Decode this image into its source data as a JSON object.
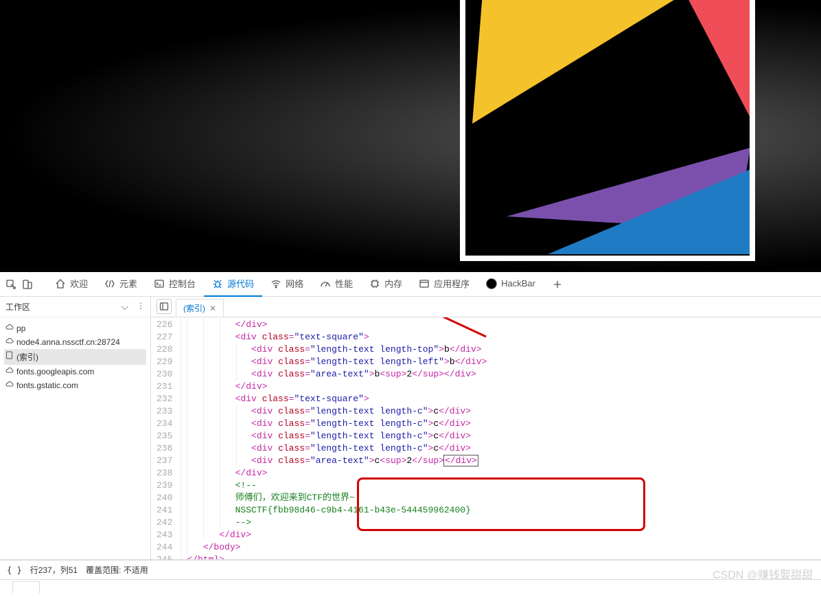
{
  "devtools": {
    "tabs": {
      "welcome": "欢迎",
      "elements": "元素",
      "console": "控制台",
      "sources": "源代码",
      "network": "网络",
      "performance": "性能",
      "memory": "内存",
      "application": "应用程序",
      "hackbar": "HackBar"
    }
  },
  "sidebar": {
    "title": "工作区",
    "items": [
      "pp",
      "node4.anna.nssctf.cn:28724",
      "(索引)",
      "fonts.googleapis.com",
      "fonts.gstatic.com"
    ]
  },
  "editor": {
    "tab": "(索引)",
    "startLine": 226,
    "lines": [
      {
        "indent": 3,
        "segs": [
          [
            "punc",
            "</"
          ],
          [
            "tag",
            "div"
          ],
          [
            "punc",
            ">"
          ]
        ]
      },
      {
        "indent": 3,
        "segs": [
          [
            "punc",
            "<"
          ],
          [
            "tag",
            "div"
          ],
          [
            "text",
            " "
          ],
          [
            "attr",
            "class"
          ],
          [
            "punc",
            "="
          ],
          [
            "str",
            "\"text-square\""
          ],
          [
            "punc",
            ">"
          ]
        ]
      },
      {
        "indent": 4,
        "segs": [
          [
            "punc",
            "<"
          ],
          [
            "tag",
            "div"
          ],
          [
            "text",
            " "
          ],
          [
            "attr",
            "class"
          ],
          [
            "punc",
            "="
          ],
          [
            "str",
            "\"length-text length-top\""
          ],
          [
            "punc",
            ">"
          ],
          [
            "text",
            "b"
          ],
          [
            "punc",
            "</"
          ],
          [
            "tag",
            "div"
          ],
          [
            "punc",
            ">"
          ]
        ]
      },
      {
        "indent": 4,
        "segs": [
          [
            "punc",
            "<"
          ],
          [
            "tag",
            "div"
          ],
          [
            "text",
            " "
          ],
          [
            "attr",
            "class"
          ],
          [
            "punc",
            "="
          ],
          [
            "str",
            "\"length-text length-left\""
          ],
          [
            "punc",
            ">"
          ],
          [
            "text",
            "b"
          ],
          [
            "punc",
            "</"
          ],
          [
            "tag",
            "div"
          ],
          [
            "punc",
            ">"
          ]
        ]
      },
      {
        "indent": 4,
        "segs": [
          [
            "punc",
            "<"
          ],
          [
            "tag",
            "div"
          ],
          [
            "text",
            " "
          ],
          [
            "attr",
            "class"
          ],
          [
            "punc",
            "="
          ],
          [
            "str",
            "\"area-text\""
          ],
          [
            "punc",
            ">"
          ],
          [
            "text",
            "b"
          ],
          [
            "punc",
            "<"
          ],
          [
            "tag",
            "sup"
          ],
          [
            "punc",
            ">"
          ],
          [
            "text",
            "2"
          ],
          [
            "punc",
            "</"
          ],
          [
            "tag",
            "sup"
          ],
          [
            "punc",
            "></"
          ],
          [
            "tag",
            "div"
          ],
          [
            "punc",
            ">"
          ]
        ]
      },
      {
        "indent": 3,
        "segs": [
          [
            "punc",
            "</"
          ],
          [
            "tag",
            "div"
          ],
          [
            "punc",
            ">"
          ]
        ]
      },
      {
        "indent": 3,
        "segs": [
          [
            "punc",
            "<"
          ],
          [
            "tag",
            "div"
          ],
          [
            "text",
            " "
          ],
          [
            "attr",
            "class"
          ],
          [
            "punc",
            "="
          ],
          [
            "str",
            "\"text-square\""
          ],
          [
            "punc",
            ">"
          ]
        ]
      },
      {
        "indent": 4,
        "segs": [
          [
            "punc",
            "<"
          ],
          [
            "tag",
            "div"
          ],
          [
            "text",
            " "
          ],
          [
            "attr",
            "class"
          ],
          [
            "punc",
            "="
          ],
          [
            "str",
            "\"length-text length-c\""
          ],
          [
            "punc",
            ">"
          ],
          [
            "text",
            "c"
          ],
          [
            "punc",
            "</"
          ],
          [
            "tag",
            "div"
          ],
          [
            "punc",
            ">"
          ]
        ]
      },
      {
        "indent": 4,
        "segs": [
          [
            "punc",
            "<"
          ],
          [
            "tag",
            "div"
          ],
          [
            "text",
            " "
          ],
          [
            "attr",
            "class"
          ],
          [
            "punc",
            "="
          ],
          [
            "str",
            "\"length-text length-c\""
          ],
          [
            "punc",
            ">"
          ],
          [
            "text",
            "c"
          ],
          [
            "punc",
            "</"
          ],
          [
            "tag",
            "div"
          ],
          [
            "punc",
            ">"
          ]
        ]
      },
      {
        "indent": 4,
        "segs": [
          [
            "punc",
            "<"
          ],
          [
            "tag",
            "div"
          ],
          [
            "text",
            " "
          ],
          [
            "attr",
            "class"
          ],
          [
            "punc",
            "="
          ],
          [
            "str",
            "\"length-text length-c\""
          ],
          [
            "punc",
            ">"
          ],
          [
            "text",
            "c"
          ],
          [
            "punc",
            "</"
          ],
          [
            "tag",
            "div"
          ],
          [
            "punc",
            ">"
          ]
        ]
      },
      {
        "indent": 4,
        "segs": [
          [
            "punc",
            "<"
          ],
          [
            "tag",
            "div"
          ],
          [
            "text",
            " "
          ],
          [
            "attr",
            "class"
          ],
          [
            "punc",
            "="
          ],
          [
            "str",
            "\"length-text length-c\""
          ],
          [
            "punc",
            ">"
          ],
          [
            "text",
            "c"
          ],
          [
            "punc",
            "</"
          ],
          [
            "tag",
            "div"
          ],
          [
            "punc",
            ">"
          ]
        ]
      },
      {
        "indent": 4,
        "segs": [
          [
            "punc",
            "<"
          ],
          [
            "tag",
            "div"
          ],
          [
            "text",
            " "
          ],
          [
            "attr",
            "class"
          ],
          [
            "punc",
            "="
          ],
          [
            "str",
            "\"area-text\""
          ],
          [
            "punc",
            ">"
          ],
          [
            "text",
            "c"
          ],
          [
            "punc",
            "<"
          ],
          [
            "tag",
            "sup"
          ],
          [
            "punc",
            ">"
          ],
          [
            "text",
            "2"
          ],
          [
            "punc",
            "</"
          ],
          [
            "tag",
            "sup"
          ],
          [
            "punc",
            ">"
          ],
          [
            "cursorOpen",
            ""
          ],
          [
            "punc",
            "</"
          ],
          [
            "tag",
            "div"
          ],
          [
            "punc",
            ">"
          ],
          [
            "cursorClose",
            ""
          ]
        ]
      },
      {
        "indent": 3,
        "segs": [
          [
            "punc",
            "</"
          ],
          [
            "tag",
            "div"
          ],
          [
            "punc",
            ">"
          ]
        ]
      },
      {
        "indent": 3,
        "segs": [
          [
            "cmt",
            "<!--"
          ]
        ]
      },
      {
        "indent": 3,
        "segs": [
          [
            "cmt",
            "师傅们，欢迎来到CTF的世界~"
          ]
        ]
      },
      {
        "indent": 3,
        "segs": [
          [
            "cmt",
            "NSSCTF{fbb98d46-c9b4-4161-b43e-544459962400}"
          ]
        ]
      },
      {
        "indent": 3,
        "segs": [
          [
            "cmt",
            "-->"
          ]
        ]
      },
      {
        "indent": 2,
        "segs": [
          [
            "punc",
            "</"
          ],
          [
            "tag",
            "div"
          ],
          [
            "punc",
            ">"
          ]
        ]
      },
      {
        "indent": 1,
        "segs": [
          [
            "punc",
            "</"
          ],
          [
            "tag",
            "body"
          ],
          [
            "punc",
            ">"
          ]
        ]
      },
      {
        "indent": 0,
        "segs": [
          [
            "punc",
            "</"
          ],
          [
            "tag",
            "html"
          ],
          [
            "punc",
            ">"
          ]
        ]
      }
    ]
  },
  "statusbar": {
    "pos": "行237，列51",
    "coverage": "覆盖范围: 不适用"
  },
  "watermark": "CSDN @赚钱娶甜甜",
  "annotation": {
    "flagLineStart": 239,
    "flagLineEnd": 242
  },
  "colors": {
    "yellow": "#f4c22a",
    "red": "#ef4e59",
    "purple": "#7a50ac",
    "blue": "#1f7bc3"
  }
}
